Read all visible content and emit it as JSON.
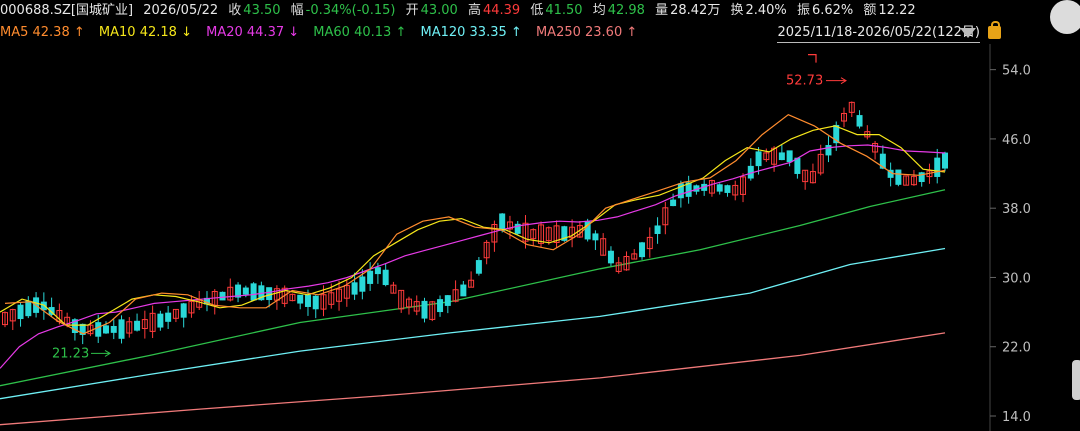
{
  "header": {
    "code": "000688.SZ[国城矿业]",
    "date": "2026/05/22",
    "close_label": "收",
    "close": "43.50",
    "change_label": "幅",
    "change": "-0.34%(-0.15)",
    "open_label": "开",
    "open": "43.00",
    "high_label": "高",
    "high": "44.39",
    "low_label": "低",
    "low": "41.50",
    "avg_label": "均",
    "avg": "42.98",
    "volume_label": "量",
    "volume": "28.42万",
    "turnover_label": "换",
    "turnover": "2.40%",
    "amplitude_label": "振",
    "amplitude": "6.62%",
    "amount_label": "额",
    "amount": "12.22"
  },
  "ma": [
    {
      "label": "MA5 42.38",
      "arrow": "↑",
      "color": "#ff8c2e"
    },
    {
      "label": "MA10 42.18",
      "arrow": "↓",
      "color": "#f5e61a"
    },
    {
      "label": "MA20 44.37",
      "arrow": "↓",
      "color": "#e63ae6"
    },
    {
      "label": "MA60 40.13",
      "arrow": "↑",
      "color": "#2ec04a"
    },
    {
      "label": "MA120 33.35",
      "arrow": "↑",
      "color": "#6ff0f5"
    },
    {
      "label": "MA250 23.60",
      "arrow": "↑",
      "color": "#f07a7a"
    }
  ],
  "range": "2025/11/18-2026/05/22(122日)",
  "colors": {
    "up": "#ff3b3b",
    "down": "#2ad8d8",
    "bg": "#000000"
  },
  "chart_data": {
    "type": "line",
    "yticks": [
      54.0,
      46.0,
      38.0,
      30.0,
      22.0,
      14.0
    ],
    "ylim": [
      12.5,
      56.5
    ],
    "annotations": [
      {
        "text": "52.73",
        "x_index": 111,
        "value": 52.73,
        "color": "#ff3b3b"
      },
      {
        "text": "21.23",
        "x_index": 14,
        "value": 21.23,
        "color": "#2ec04a"
      }
    ],
    "series": [
      {
        "key": "MA250",
        "values": [
          13.0,
          24.0
        ]
      },
      {
        "key": "MA120",
        "values": [
          16.0,
          33.35
        ]
      },
      {
        "key": "MA60",
        "values": [
          17.5,
          40.13
        ]
      }
    ],
    "ma_curves": {
      "MA20": [
        19.5,
        22.0,
        23.5,
        24.3,
        25.0,
        25.8,
        26.0,
        26.5,
        27.0,
        27.2,
        27.4,
        27.6,
        27.8,
        28.0,
        28.3,
        28.7,
        29.0,
        29.4,
        30.0,
        30.8,
        31.6,
        32.5,
        33.1,
        33.7,
        34.3,
        34.9,
        35.5,
        36.0,
        36.3,
        36.5,
        36.4,
        36.6,
        37.0,
        37.7,
        38.4,
        39.4,
        40.1,
        40.8,
        41.4,
        42.1,
        42.7,
        43.3,
        44.6,
        45.0,
        45.2,
        45.3,
        45.0,
        44.6,
        44.5,
        44.37
      ],
      "MA10": [
        26.0,
        27.5,
        26.8,
        24.5,
        24.5,
        26.0,
        27.5,
        28.0,
        27.8,
        27.2,
        26.5,
        26.8,
        27.8,
        28.5,
        28.0,
        28.8,
        30.0,
        32.5,
        34.0,
        35.5,
        36.5,
        36.8,
        35.8,
        35.5,
        34.4,
        34.0,
        34.8,
        36.5,
        38.4,
        39.0,
        39.5,
        40.5,
        41.5,
        43.5,
        45.0,
        44.5,
        46.0,
        47.0,
        47.5,
        46.5,
        46.5,
        45.0,
        42.5,
        42.18
      ],
      "MA5": [
        27.0,
        27.2,
        25.0,
        23.5,
        24.8,
        27.5,
        28.2,
        28.0,
        26.8,
        26.5,
        26.5,
        28.5,
        28.0,
        29.0,
        31.0,
        35.0,
        36.5,
        37.0,
        35.8,
        35.5,
        33.8,
        33.2,
        35.0,
        38.0,
        39.0,
        40.0,
        41.0,
        41.5,
        43.5,
        46.5,
        48.8,
        47.5,
        45.5,
        44.0,
        42.0,
        41.8,
        42.38
      ]
    }
  }
}
